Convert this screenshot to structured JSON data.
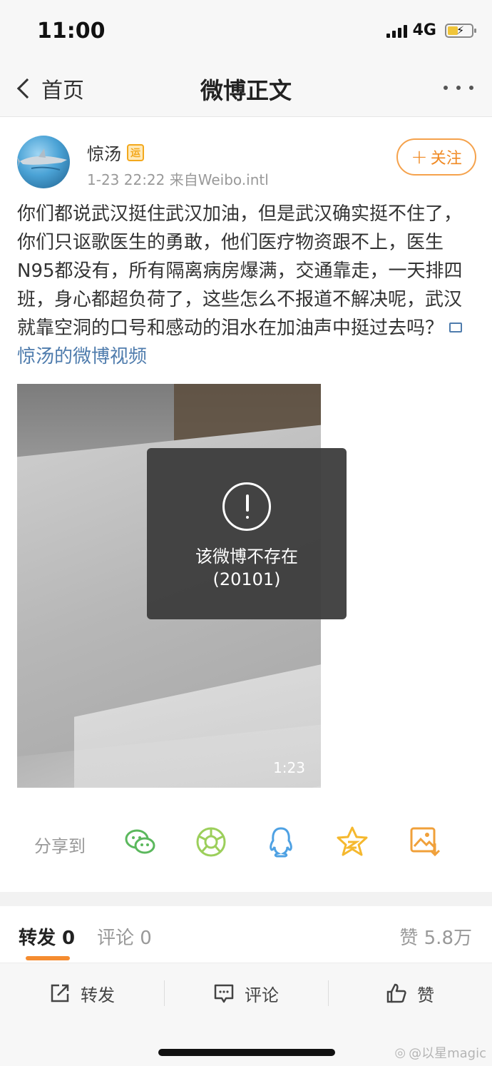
{
  "status_bar": {
    "time": "11:00",
    "network": "4G"
  },
  "nav": {
    "back_label": "首页",
    "title": "微博正文"
  },
  "post": {
    "author": "惊汤",
    "badge": "运",
    "meta": "1-23 22:22  来自Weibo.intl",
    "follow_label": "关注",
    "text": "你们都说武汉挺住武汉加油，但是武汉确实挺不住了，你们只讴歌医生的勇敢，他们医疗物资跟不上，医生N95都没有，所有隔离病房爆满，交通靠走，一天排四班，身心都超负荷了，这些怎么不报道不解决呢，武汉就靠空洞的口号和感动的泪水在加油声中挺过去吗？",
    "video_link": "惊汤的微博视频",
    "video_duration": "1:23"
  },
  "toast": {
    "line1": "该微博不存在",
    "line2": "(20101)"
  },
  "share": {
    "label": "分享到",
    "icons": [
      "wechat-icon",
      "moments-icon",
      "qq-icon",
      "qzone-icon",
      "save-image-icon"
    ]
  },
  "tabs": {
    "repost": "转发 0",
    "comment": "评论 0",
    "like": "赞 5.8万"
  },
  "actions": {
    "repost": "转发",
    "comment": "评论",
    "like": "赞"
  },
  "watermark": "@以星magic",
  "colors": {
    "accent": "#f58c30",
    "link": "#4f7cad",
    "share_green": "#5bb85d",
    "share_lime": "#9ccf5b",
    "share_blue": "#4ea1e3",
    "share_yellow": "#f5b82e",
    "share_orange": "#f0a03a"
  }
}
